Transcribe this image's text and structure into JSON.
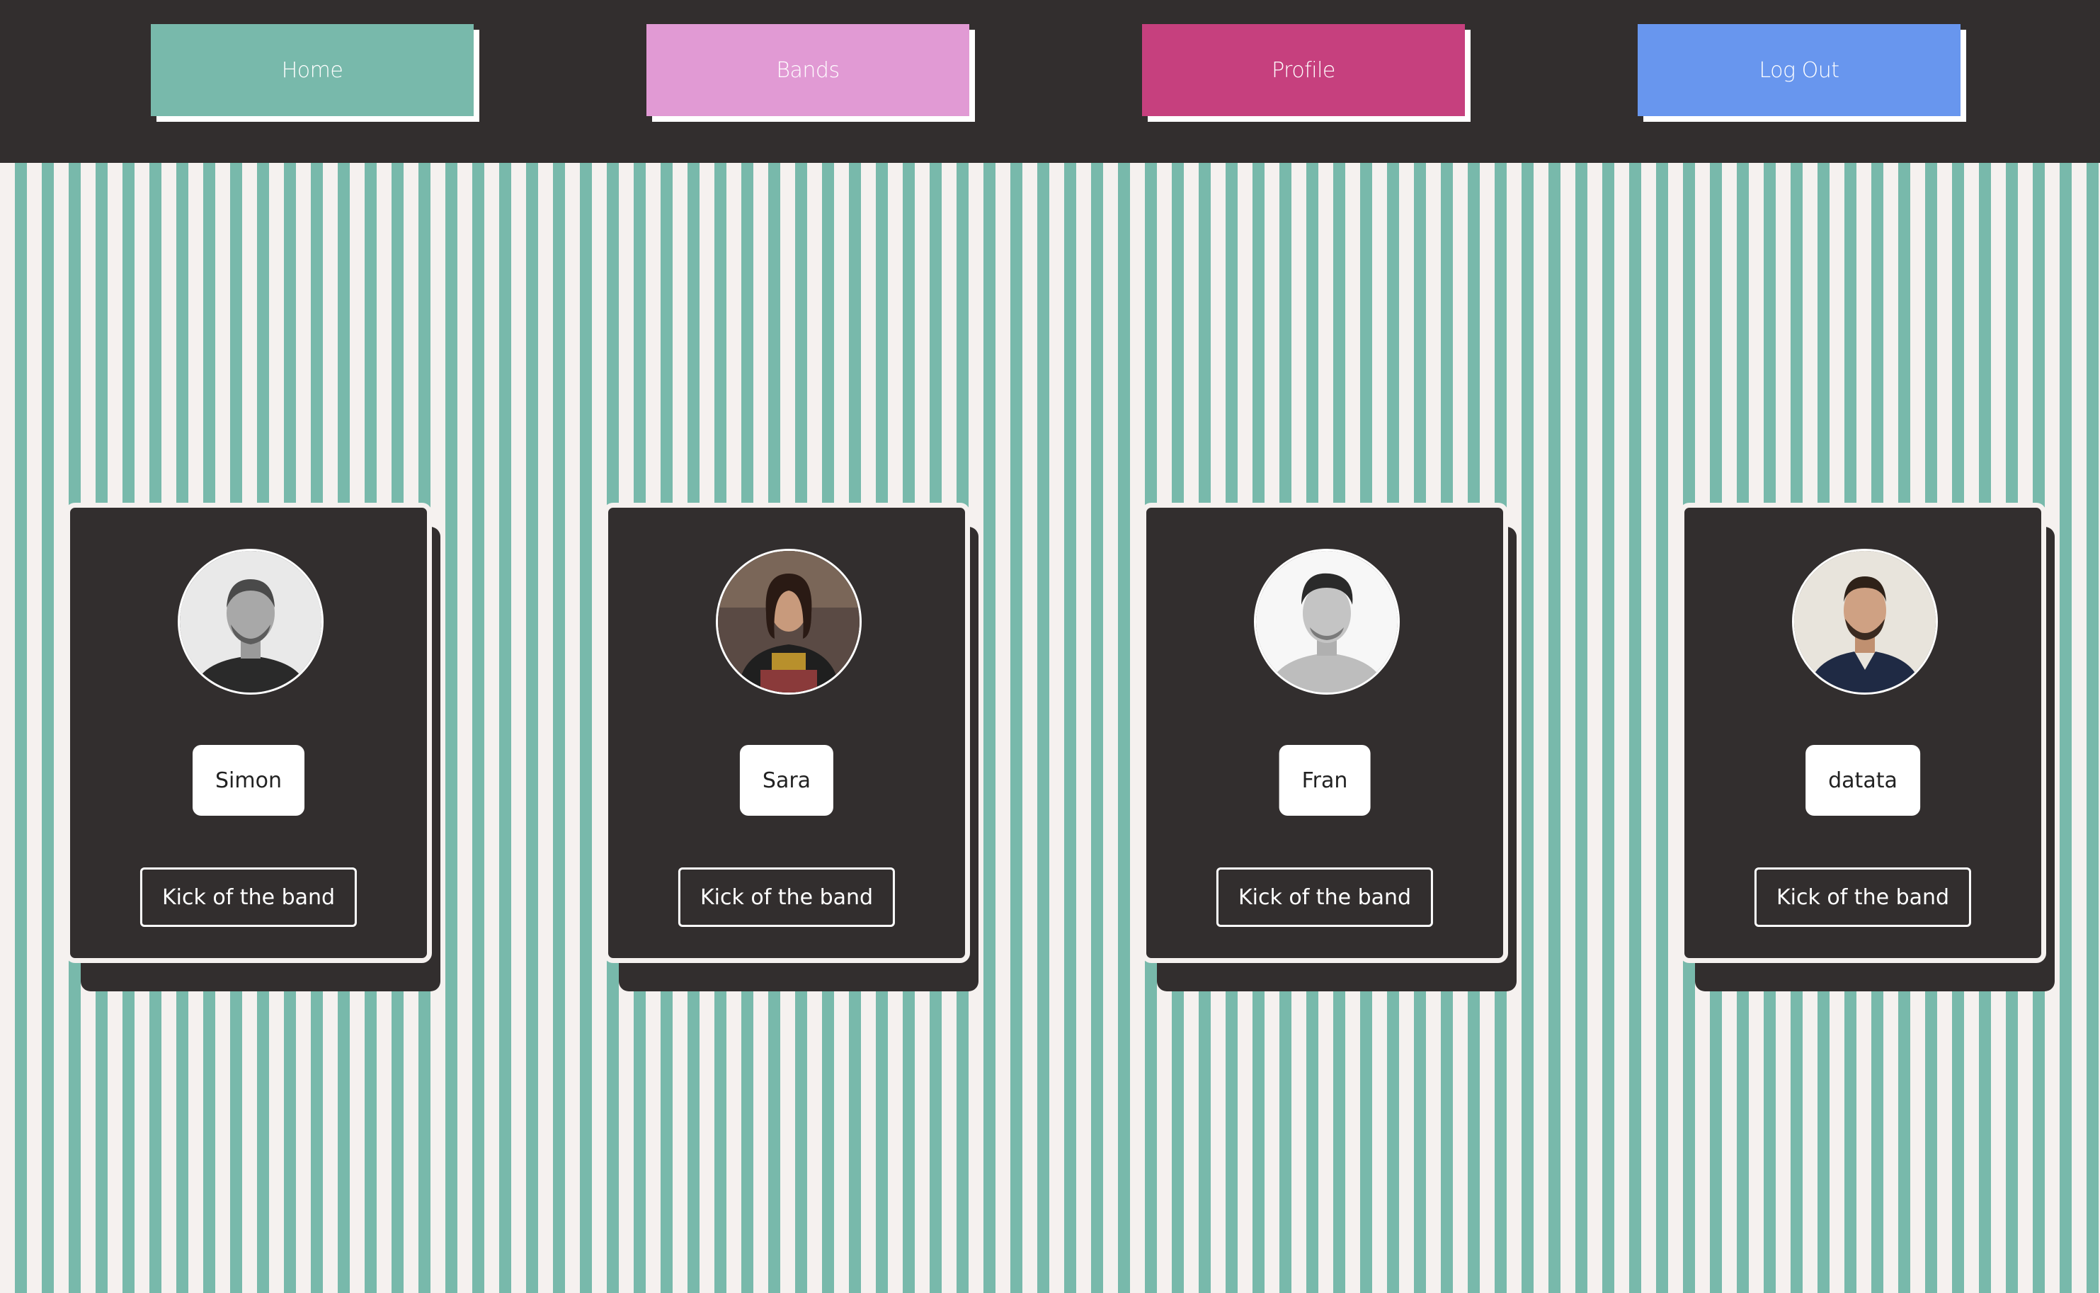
{
  "nav": {
    "items": [
      {
        "label": "Home",
        "color": "#78b9ab"
      },
      {
        "label": "Bands",
        "color": "#e19ad4"
      },
      {
        "label": "Profile",
        "color": "#c6407e"
      },
      {
        "label": "Log Out",
        "color": "#6896ee"
      }
    ]
  },
  "theme": {
    "dark": "#322e2e",
    "stripe_light": "#f5f1ef",
    "stripe_teal": "#78b9ab"
  },
  "members": [
    {
      "name": "Simon",
      "kick_label": "Kick of the band",
      "avatar": "person-photo-icon"
    },
    {
      "name": "Sara",
      "kick_label": "Kick of the band",
      "avatar": "person-photo-icon"
    },
    {
      "name": "Fran",
      "kick_label": "Kick of the band",
      "avatar": "person-photo-icon"
    },
    {
      "name": "datata",
      "kick_label": "Kick of the band",
      "avatar": "person-photo-icon"
    }
  ]
}
